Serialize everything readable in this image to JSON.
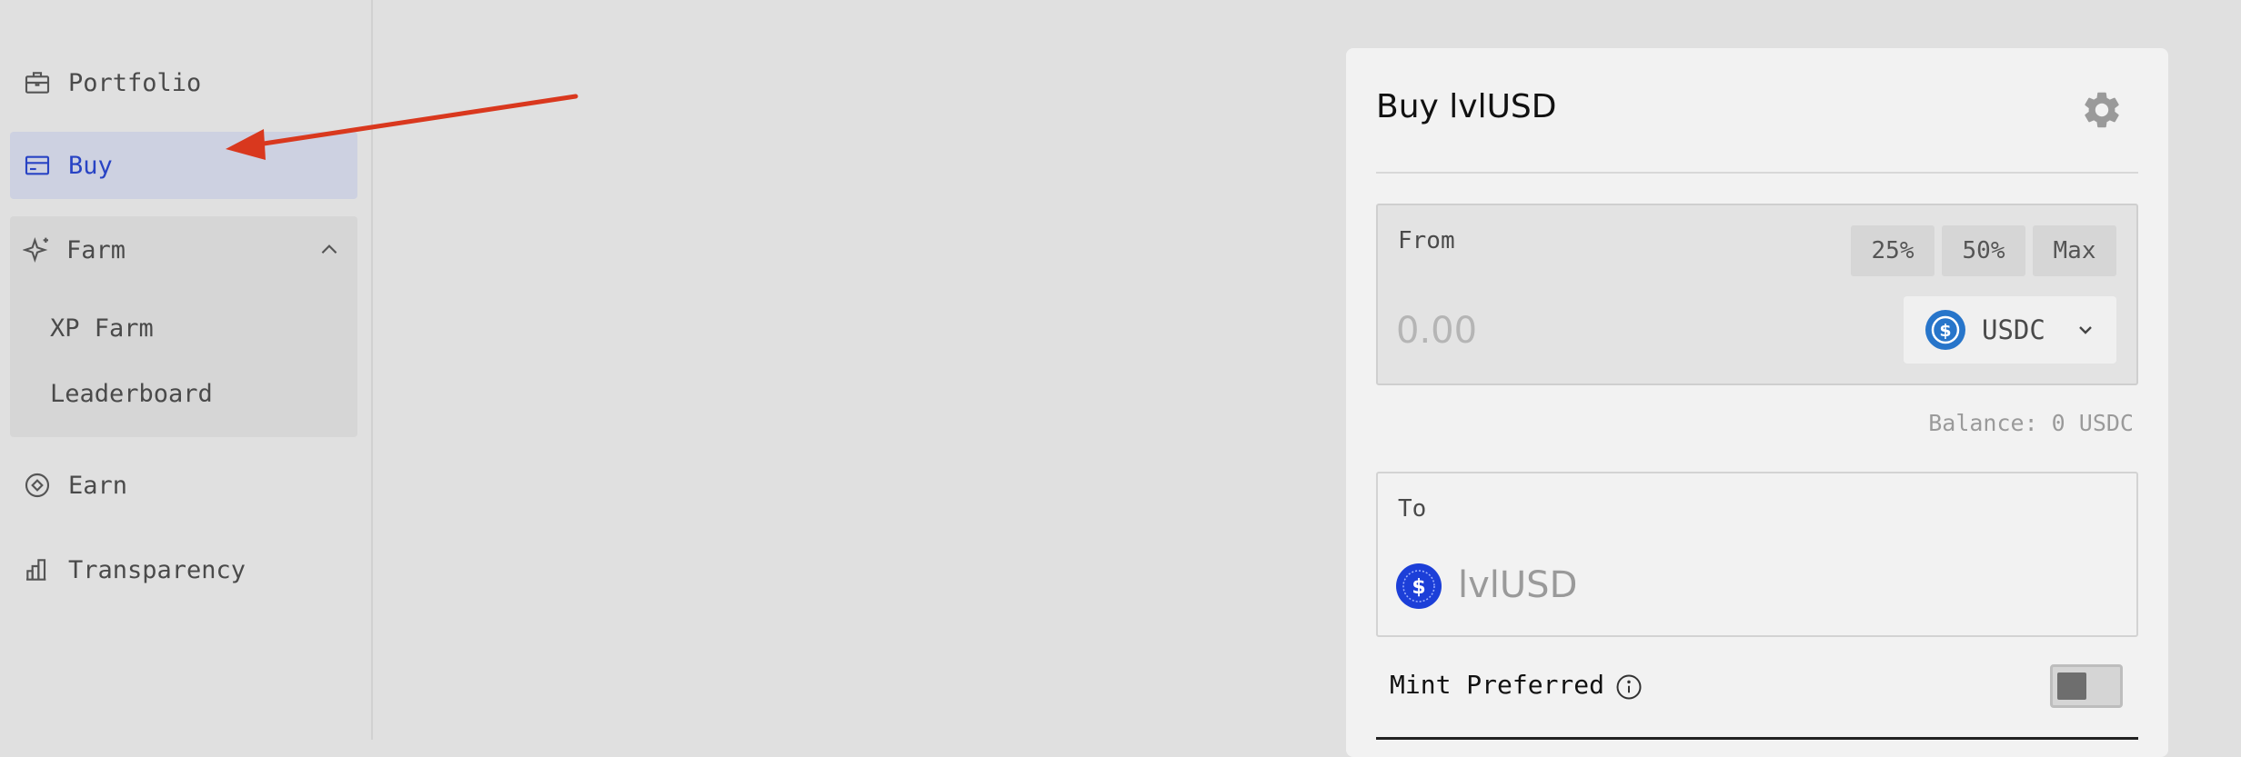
{
  "sidebar": {
    "items": {
      "portfolio": {
        "label": "Portfolio",
        "icon": "briefcase-icon"
      },
      "buy": {
        "label": "Buy",
        "icon": "credit-card-icon",
        "active": true
      },
      "farm": {
        "label": "Farm",
        "icon": "sparkle-icon",
        "expanded": true,
        "children": [
          "XP Farm",
          "Leaderboard"
        ]
      },
      "earn": {
        "label": "Earn",
        "icon": "earn-coin-icon"
      },
      "transparency": {
        "label": "Transparency",
        "icon": "bar-chart-icon"
      }
    }
  },
  "card": {
    "title": "Buy lvlUSD",
    "settings_icon": "gear-icon",
    "from": {
      "label": "From",
      "pct_buttons": [
        "25%",
        "50%",
        "Max"
      ],
      "amount_placeholder": "0.00",
      "token": "USDC",
      "token_icon": "usdc-icon"
    },
    "balance": "Balance: 0 USDC",
    "to": {
      "label": "To",
      "token": "lvlUSD",
      "token_icon": "lvlusd-icon"
    },
    "mint_preferred": {
      "label": "Mint Preferred",
      "enabled": false
    }
  },
  "colors": {
    "accent_blue": "#2843c4",
    "active_bg": "#cdd1e1",
    "arrow_red": "#d9381e",
    "usdc_blue": "#2775ca"
  }
}
